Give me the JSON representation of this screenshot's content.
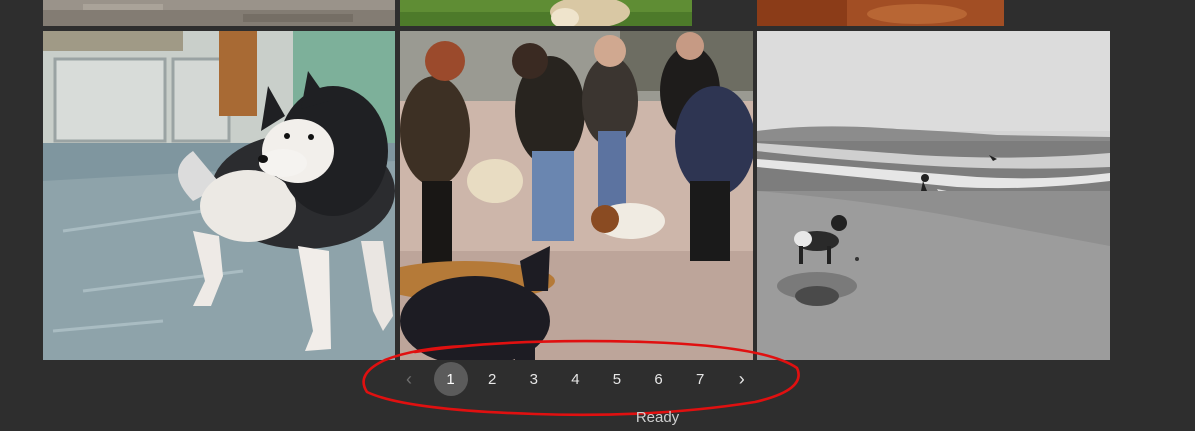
{
  "gallery": {
    "photos": [
      {
        "subject": "dirt-ground-photo"
      },
      {
        "subject": "dog-on-grass-photo"
      },
      {
        "subject": "red-soil-photo"
      },
      {
        "subject": "malamute-dog-photo"
      },
      {
        "subject": "people-with-dogs-photo"
      },
      {
        "subject": "dog-on-beach-photo"
      }
    ]
  },
  "pagination": {
    "prev_icon": "‹",
    "next_icon": "›",
    "pages": [
      "1",
      "2",
      "3",
      "4",
      "5",
      "6",
      "7"
    ],
    "current": "1"
  },
  "annotation": {
    "color": "#e01010",
    "shape": "hand-drawn-ellipse"
  },
  "status": {
    "text": "Ready"
  }
}
